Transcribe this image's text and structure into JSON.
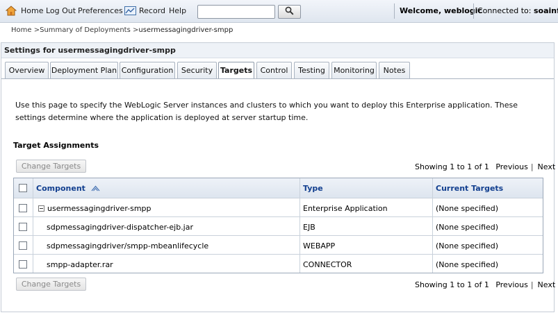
{
  "toolbar": {
    "home_label": "Home",
    "logout_label": "Log Out",
    "preferences_label": "Preferences",
    "record_label": "Record",
    "help_label": "Help",
    "search_value": "",
    "welcome_text": "Welcome, weblogic",
    "connected_label": "Connected to:",
    "connected_server": "soainfra"
  },
  "breadcrumb": {
    "items": [
      "Home",
      "Summary of Deployments",
      "usermessagingdriver-smpp"
    ],
    "separator": ">"
  },
  "panel": {
    "title": "Settings for usermessagingdriver-smpp",
    "tabs": [
      "Overview",
      "Deployment Plan",
      "Configuration",
      "Security",
      "Targets",
      "Control",
      "Testing",
      "Monitoring",
      "Notes"
    ],
    "active_tab": "Targets",
    "description": "Use this page to specify the WebLogic Server instances and clusters to which you want to deploy this Enterprise application. These settings determine where the application is deployed at server startup time."
  },
  "assignments": {
    "title": "Target Assignments",
    "change_targets_label": "Change Targets",
    "pager_text": "Showing 1 to 1 of 1",
    "previous_label": "Previous",
    "next_label": "Next",
    "columns": [
      "Component",
      "Type",
      "Current Targets"
    ],
    "rows": [
      {
        "component": "usermessagingdriver-smpp",
        "type": "Enterprise Application",
        "targets": "(None specified)"
      },
      {
        "component": "sdpmessagingdriver-dispatcher-ejb.jar",
        "type": "EJB",
        "targets": "(None specified)"
      },
      {
        "component": "sdpmessagingdriver/smpp-mbeanlifecycle",
        "type": "WEBAPP",
        "targets": "(None specified)"
      },
      {
        "component": "smpp-adapter.rar",
        "type": "CONNECTOR",
        "targets": "(None specified)"
      }
    ]
  },
  "icons": {
    "home": "home-icon",
    "preferences": "preferences-icon",
    "search": "search-icon",
    "sort": "sort-ascending-icon",
    "expander": "collapse-icon"
  },
  "colors": {
    "header_text": "#123f8f",
    "toolbar_bg": "#e8edf4",
    "border": "#9aa7b8"
  }
}
